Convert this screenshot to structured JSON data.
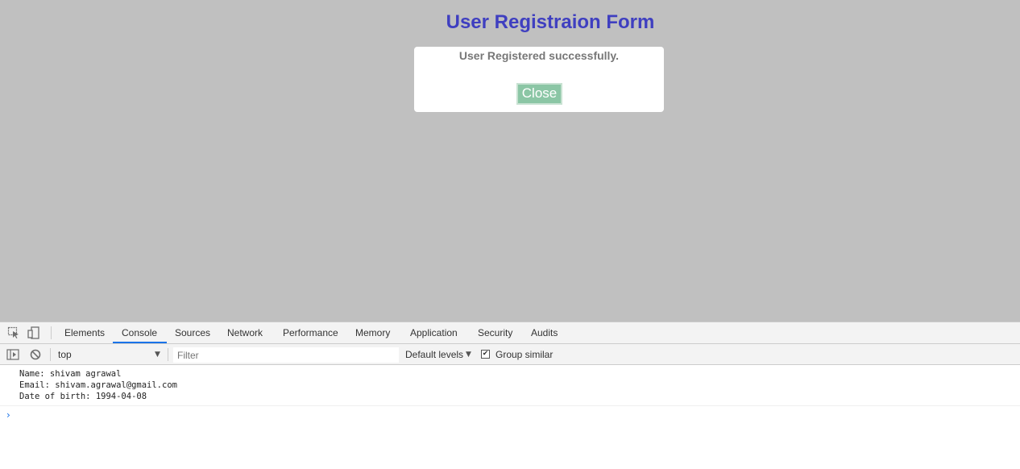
{
  "page": {
    "title": "User Registraion Form",
    "modal": {
      "message": "User Registered successfully.",
      "close_label": "Close"
    }
  },
  "devtools": {
    "tabs": [
      {
        "label": "Elements"
      },
      {
        "label": "Console",
        "active": true
      },
      {
        "label": "Sources"
      },
      {
        "label": "Network"
      },
      {
        "label": "Performance"
      },
      {
        "label": "Memory"
      },
      {
        "label": "Application"
      },
      {
        "label": "Security"
      },
      {
        "label": "Audits"
      }
    ],
    "toolbar": {
      "context": "top",
      "filter_placeholder": "Filter",
      "levels_label": "Default levels",
      "group_similar_label": "Group similar",
      "group_similar_checked": true
    },
    "console": {
      "lines": [
        "Name: shivam agrawal",
        "Email: shivam.agrawal@gmail.com",
        "Date of birth: 1994-04-08"
      ],
      "prompt_symbol": "›"
    }
  },
  "colors": {
    "overlay": "#c0c0c0",
    "title": "#3f3fc0",
    "close_button": "#8bc6a5",
    "devtools_accent": "#1a73e8"
  }
}
